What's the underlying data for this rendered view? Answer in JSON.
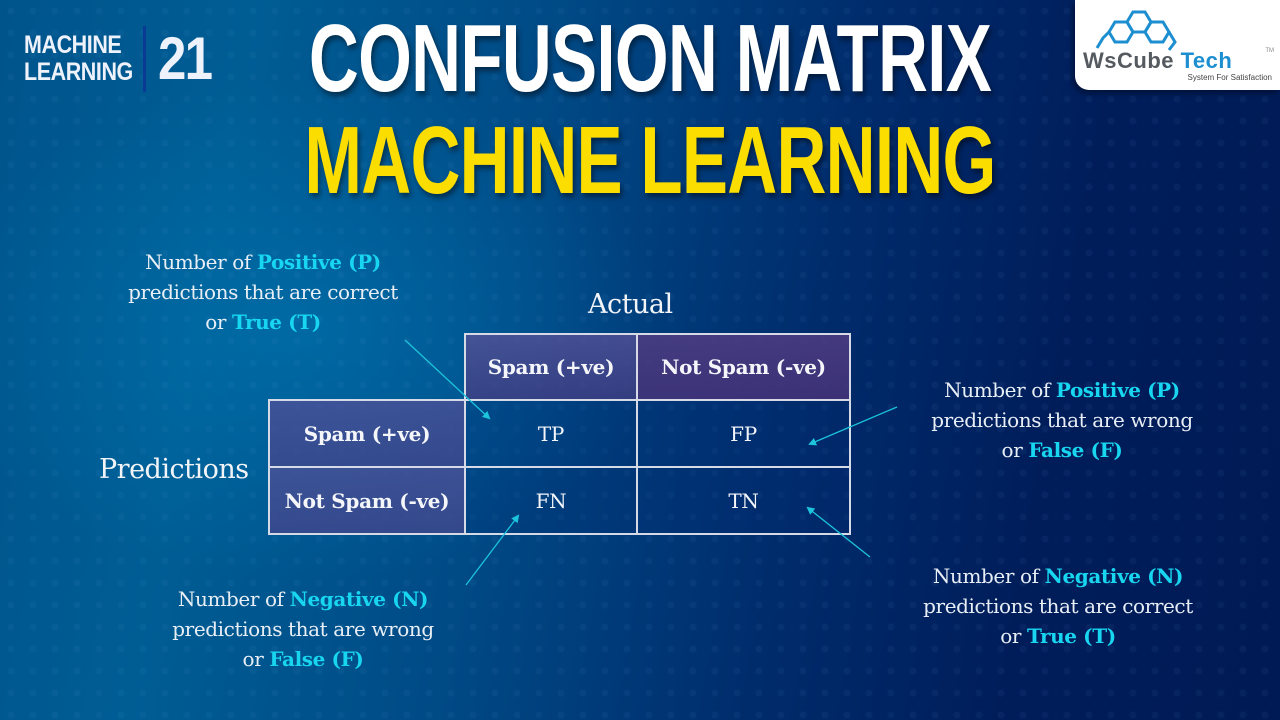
{
  "series": {
    "name_line1": "MACHINE",
    "name_line2": "LEARNING",
    "episode": "21"
  },
  "title": {
    "line1": "CONFUSION MATRIX",
    "line2": "MACHINE LEARNING"
  },
  "logo": {
    "brand_part1": "WsCube",
    "brand_part2": "Tech",
    "trademark": "TM",
    "tagline": "System For Satisfaction"
  },
  "matrix": {
    "actual_label": "Actual",
    "predictions_label": "Predictions",
    "column_headers": [
      "Spam (+ve)",
      "Not Spam (-ve)"
    ],
    "row_headers": [
      "Spam (+ve)",
      "Not Spam (-ve)"
    ],
    "cells": [
      [
        "TP",
        "FP"
      ],
      [
        "FN",
        "TN"
      ]
    ]
  },
  "notes": {
    "tp": {
      "pre": "Number of ",
      "k1": "Positive (P)",
      "mid": "predictions that are correct",
      "or": "or ",
      "k2": "True (T)"
    },
    "fp": {
      "pre": "Number of ",
      "k1": "Positive (P)",
      "mid": "predictions that are wrong",
      "or": "or ",
      "k2": "False (F)"
    },
    "fn": {
      "pre": "Number of ",
      "k1": "Negative (N)",
      "mid": "predictions that are wrong",
      "or": "or ",
      "k2": "False (F)"
    },
    "tn": {
      "pre": "Number of ",
      "k1": "Negative (N)",
      "mid": "predictions that are correct",
      "or": "or ",
      "k2": "True (T)"
    }
  },
  "colors": {
    "highlight": "#18d6f0",
    "title_yellow": "#fcdd00",
    "arrow": "#1cc4dc"
  }
}
